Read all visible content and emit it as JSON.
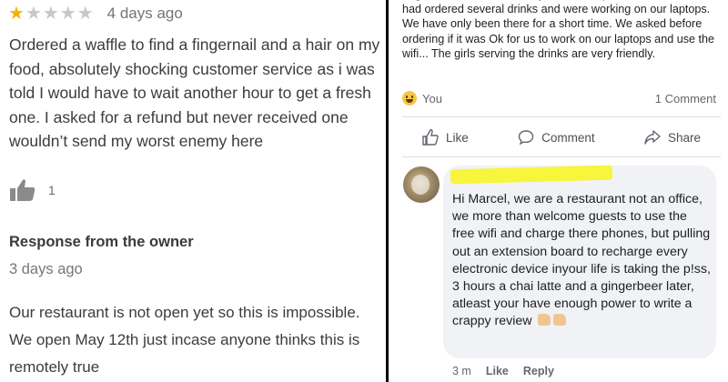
{
  "review": {
    "stars_filled": 1,
    "stars_total": 5,
    "star_color": "#f4b400",
    "date": "4 days ago",
    "text": "Ordered a waffle to find a fingernail and a hair on my food, absolutely shocking customer service as i was told I would have to wait another hour to get a fresh one. I asked for a refund but never received one wouldn’t send my worst enemy here",
    "like_count": "1"
  },
  "owner_response": {
    "title": "Response from the owner",
    "date": "3 days ago",
    "text": "Our restaurant is not open yet so this is impossible. We open May 12th just incase anyone thinks this is remotely true"
  },
  "post": {
    "text": "to go because the electricity was too expensive for them. We had ordered several drinks and were working on our laptops. We have only been there for a short time. We asked before ordering if it was Ok for us to work on our laptops and use the wifi... The girls serving the drinks are very friendly.",
    "reactor": "You",
    "comment_count": "1 Comment",
    "actions": {
      "like": "Like",
      "comment": "Comment",
      "share": "Share"
    }
  },
  "comment": {
    "text": "Hi Marcel, we are a restaurant not an office, we more than welcome guests to use the free wifi and charge there phones, but pulling out an extension board to recharge every electronic device inyour life is taking the p!ss, 3 hours a chai latte and a gingerbeer later, atleast your have enough power to write a crappy review",
    "time": "3 m",
    "like": "Like",
    "reply": "Reply",
    "highlight_color": "#f7f53c"
  }
}
